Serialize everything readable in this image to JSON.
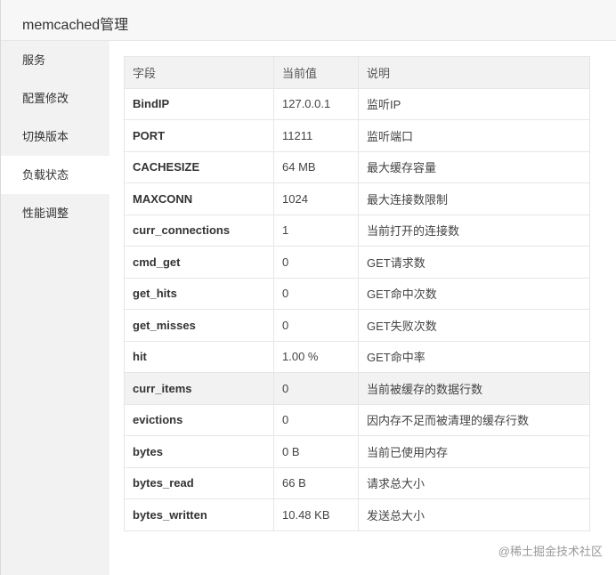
{
  "window": {
    "title": "memcached管理"
  },
  "sidebar": {
    "items": [
      {
        "label": "服务",
        "active": false
      },
      {
        "label": "配置修改",
        "active": false
      },
      {
        "label": "切换版本",
        "active": false
      },
      {
        "label": "负载状态",
        "active": true
      },
      {
        "label": "性能调整",
        "active": false
      }
    ]
  },
  "table": {
    "headers": [
      "字段",
      "当前值",
      "说明"
    ],
    "rows": [
      {
        "field": "BindIP",
        "value": "127.0.0.1",
        "desc": "监听IP"
      },
      {
        "field": "PORT",
        "value": "11211",
        "desc": "监听端口"
      },
      {
        "field": "CACHESIZE",
        "value": "64 MB",
        "desc": "最大缓存容量"
      },
      {
        "field": "MAXCONN",
        "value": "1024",
        "desc": "最大连接数限制"
      },
      {
        "field": "curr_connections",
        "value": "1",
        "desc": "当前打开的连接数"
      },
      {
        "field": "cmd_get",
        "value": "0",
        "desc": "GET请求数"
      },
      {
        "field": "get_hits",
        "value": "0",
        "desc": "GET命中次数"
      },
      {
        "field": "get_misses",
        "value": "0",
        "desc": "GET失败次数"
      },
      {
        "field": "hit",
        "value": "1.00 %",
        "desc": "GET命中率"
      },
      {
        "field": "curr_items",
        "value": "0",
        "desc": "当前被缓存的数据行数"
      },
      {
        "field": "evictions",
        "value": "0",
        "desc": "因内存不足而被清理的缓存行数"
      },
      {
        "field": "bytes",
        "value": "0 B",
        "desc": "当前已使用内存"
      },
      {
        "field": "bytes_read",
        "value": "66 B",
        "desc": "请求总大小"
      },
      {
        "field": "bytes_written",
        "value": "10.48 KB",
        "desc": "发送总大小"
      }
    ]
  },
  "watermark": "@稀土掘金技术社区"
}
